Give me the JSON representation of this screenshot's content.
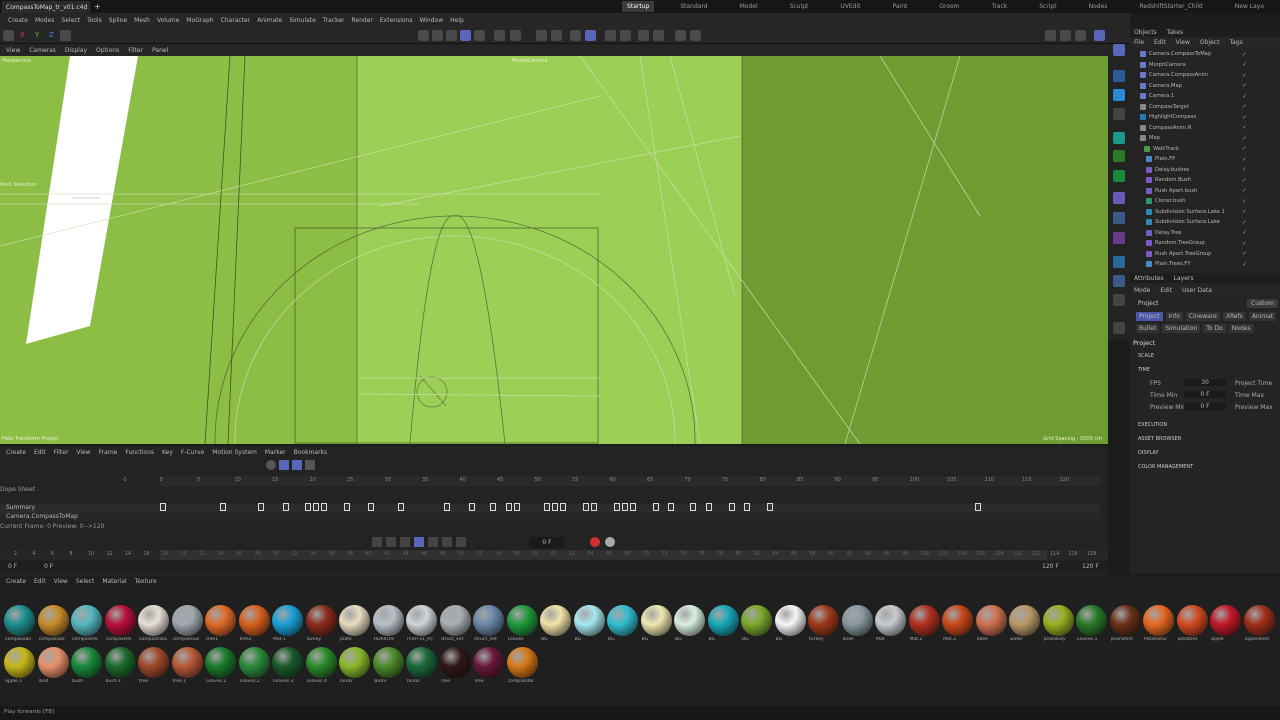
{
  "window": {
    "tab_title": "CompassToMap_tr_v01.c4d",
    "new_tab": "+"
  },
  "layouts": [
    "Startup",
    "Standard",
    "Model",
    "Sculpt",
    "UVEdit",
    "Paint",
    "Groom",
    "Track",
    "Script",
    "Nodes",
    "RedshiftStarter_Child"
  ],
  "layout_new": "New Layo",
  "menu": [
    "Create",
    "Modes",
    "Select",
    "Tools",
    "Spline",
    "Mesh",
    "Volume",
    "MoGraph",
    "Character",
    "Animate",
    "Simulate",
    "Tracker",
    "Render",
    "Extensions",
    "Window",
    "Help"
  ],
  "axis": {
    "x": "X",
    "y": "Y",
    "z": "Z"
  },
  "viewport_menu": [
    "View",
    "Cameras",
    "Display",
    "Options",
    "Filter",
    "Panel"
  ],
  "viewport": {
    "left_label": "Perspective",
    "camera_label": "MorphCamera",
    "selection_label": "Push Selection",
    "bottom_label": "Hide Transform Project",
    "grid": "Grid Spacing : 5000 cm"
  },
  "objects_tabs": [
    "Objects",
    "Takes"
  ],
  "objects_menu": [
    "File",
    "Edit",
    "View",
    "Object",
    "Tags"
  ],
  "objects": [
    "Camera.CompassToMap",
    "MorphCamera",
    "Camera.CompassAnim",
    "Camera.Map",
    "Camera.1",
    "CompassTarget",
    "HighlightCompass",
    "CompassAnim.R",
    "Map",
    "WalkTrack",
    "Plain.FP",
    "Delay.bushes",
    "Random.Bush",
    "Push Apart.bush",
    "Cloner.bush",
    "Subdivision Surface.Lake.1",
    "Subdivision Surface.Lake",
    "Delay.Tree",
    "Random.TreeGroup",
    "Push Apart.TreeGroup",
    "Plain.Trees.FY"
  ],
  "attributes": {
    "tabs": [
      "Attributes",
      "Layers"
    ],
    "menu": [
      "Mode",
      "Edit",
      "User Data"
    ],
    "title": "Project",
    "custom": "Custom",
    "subtabs1": [
      "Project",
      "Info",
      "Cineware",
      "XRefs",
      "Animat"
    ],
    "subtabs2": [
      "Bullet",
      "Simulation",
      "To Do",
      "Nodes"
    ],
    "section": "Project",
    "groups": [
      "SCALE",
      "TIME",
      "EXECUTION",
      "ASSET BROWSER",
      "DISPLAY",
      "COLOR MANAGEMENT"
    ],
    "fps_label": "FPS",
    "fps": "30",
    "time_min_label": "Time Min",
    "time_min": "0 F",
    "preview_min_label": "Preview Min",
    "preview_min": "0 F",
    "project_time_label": "Project Time",
    "time_max_label": "Time Max",
    "preview_max_label": "Preview Max"
  },
  "timeline": {
    "menu": [
      "Create",
      "Edit",
      "Filter",
      "View",
      "Frame",
      "Functions",
      "Key",
      "F-Curve",
      "Motion System",
      "Marker",
      "Bookmarks"
    ],
    "dopesheet": "Dope Sheet",
    "tracks": [
      "Summary",
      "Camera.CompassToMap"
    ],
    "current": "Current Frame: 0  Preview: 0-->120",
    "ruler": [
      "-5",
      "0",
      "5",
      "10",
      "15",
      "20",
      "25",
      "30",
      "35",
      "40",
      "45",
      "50",
      "55",
      "60",
      "65",
      "70",
      "75",
      "80",
      "85",
      "90",
      "95",
      "100",
      "105",
      "110",
      "115",
      "120"
    ],
    "frame_field": "0 F",
    "bottom_ruler": [
      "2",
      "4",
      "6",
      "8",
      "10",
      "12",
      "14",
      "16",
      "18",
      "20",
      "22",
      "24",
      "26",
      "28",
      "30",
      "32",
      "34",
      "36",
      "38",
      "40",
      "42",
      "44",
      "46",
      "48",
      "50",
      "52",
      "54",
      "56",
      "58",
      "60",
      "62",
      "64",
      "66",
      "68",
      "70",
      "72",
      "74",
      "76",
      "78",
      "80",
      "82",
      "84",
      "86",
      "88",
      "90",
      "92",
      "94",
      "96",
      "98",
      "100",
      "102",
      "104",
      "106",
      "108",
      "110",
      "112",
      "114",
      "116",
      "118"
    ],
    "start": "0 F",
    "start2": "0 F",
    "end": "120 F",
    "end2": "120 F"
  },
  "materials_menu": [
    "Create",
    "Edit",
    "View",
    "Select",
    "Material",
    "Texture"
  ],
  "materials_row1": [
    {
      "label": "compassbo",
      "color": "#1d8f8f"
    },
    {
      "label": "compassbo",
      "color": "#c88b2a"
    },
    {
      "label": "compassPo",
      "color": "#56b8c0"
    },
    {
      "label": "compassPo",
      "color": "#b8103a"
    },
    {
      "label": "compassSta",
      "color": "#e8e0d6"
    },
    {
      "label": "compassGo",
      "color": "#a0a8b0"
    },
    {
      "label": "tree1",
      "color": "#e06a2a"
    },
    {
      "label": "tree2",
      "color": "#d8601e"
    },
    {
      "label": "Mat.1",
      "color": "#18a0d8"
    },
    {
      "label": "turkey",
      "color": "#8a2c1a"
    },
    {
      "label": "plate",
      "color": "#e8dcc0"
    },
    {
      "label": "HDRI019",
      "color": "#b8c0c8"
    },
    {
      "label": "[hdri-v1_H]",
      "color": "#d0d4d8"
    },
    {
      "label": "struct_ext",
      "color": "#a8aeb2"
    },
    {
      "label": "struct_ext",
      "color": "#6a88a8"
    },
    {
      "label": "Leaves",
      "color": "#1e9a3a"
    },
    {
      "label": "BG",
      "color": "#f2e4a8"
    },
    {
      "label": "BG",
      "color": "#a8e8f0"
    },
    {
      "label": "BG",
      "color": "#30c0d0"
    },
    {
      "label": "BG",
      "color": "#f0e8b0"
    },
    {
      "label": "BG",
      "color": "#d8f0e0"
    },
    {
      "label": "BG",
      "color": "#16a8b8"
    },
    {
      "label": "BG",
      "color": "#7aaa2a"
    },
    {
      "label": "BG",
      "color": "#f8f8f8"
    },
    {
      "label": "turkey",
      "color": "#a03818"
    },
    {
      "label": "bowl",
      "color": "#8898a0"
    },
    {
      "label": "Mat",
      "color": "#c8ccd0"
    },
    {
      "label": "Mat.2",
      "color": "#b03020"
    },
    {
      "label": "Mat.3",
      "color": "#c84818"
    },
    {
      "label": "table",
      "color": "#d07050"
    },
    {
      "label": "water",
      "color": "#b89868"
    },
    {
      "label": "pearBody",
      "color": "#98b020"
    },
    {
      "label": "Leaves.1",
      "color": "#2a7a2a"
    },
    {
      "label": "pearStem",
      "color": "#6a3018"
    },
    {
      "label": "Potatoes2",
      "color": "#e86820"
    },
    {
      "label": "potatoes",
      "color": "#d04a20"
    },
    {
      "label": "apple",
      "color": "#c01828"
    },
    {
      "label": "appleStem",
      "color": "#a03018"
    }
  ],
  "materials_row2": [
    {
      "label": "apple.1",
      "color": "#c8b818"
    },
    {
      "label": "land",
      "color": "#e8906a"
    },
    {
      "label": "bush",
      "color": "#1a8a3a"
    },
    {
      "label": "bush.1",
      "color": "#1a6a2a"
    },
    {
      "label": "tree",
      "color": "#a04828"
    },
    {
      "label": "tree.1",
      "color": "#b85838"
    },
    {
      "label": "Leaves.2",
      "color": "#1a7a2a"
    },
    {
      "label": "Leaves.2",
      "color": "#2a8a3a"
    },
    {
      "label": "Leaves.3",
      "color": "#1a5a2a"
    },
    {
      "label": "Leaves.4",
      "color": "#2a8a2a"
    },
    {
      "label": "land2",
      "color": "#88b828"
    },
    {
      "label": "land3",
      "color": "#4a8a28"
    },
    {
      "label": "land2",
      "color": "#1a6a3a"
    },
    {
      "label": "Tree",
      "color": "#301818"
    },
    {
      "label": "Tree",
      "color": "#681838"
    },
    {
      "label": "compassbo",
      "color": "#d87818"
    }
  ],
  "status": "Play forwards [F8]"
}
